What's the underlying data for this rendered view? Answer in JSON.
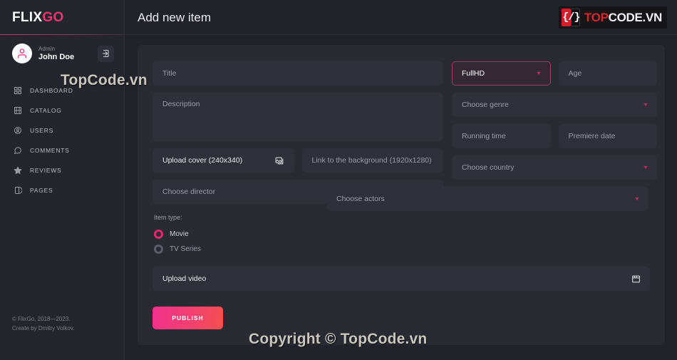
{
  "brand": {
    "part1": "FLIX",
    "part2": "GO"
  },
  "user": {
    "role": "Admin",
    "name": "John Doe",
    "logout_icon": "logout-icon",
    "avatar_icon": "user-avatar-icon"
  },
  "sidebar": {
    "items": [
      {
        "label": "DASHBOARD",
        "icon": "grid-icon"
      },
      {
        "label": "CATALOG",
        "icon": "film-icon"
      },
      {
        "label": "USERS",
        "icon": "user-circle-icon"
      },
      {
        "label": "COMMENTS",
        "icon": "comment-icon"
      },
      {
        "label": "REVIEWS",
        "icon": "star-icon"
      },
      {
        "label": "PAGES",
        "icon": "pages-icon"
      }
    ],
    "footer_line1": "© FlixGo, 2018—2023.",
    "footer_line2": "Create by Dmitry Volkov."
  },
  "header": {
    "title": "Add new item",
    "logo": {
      "glyph": "{/}",
      "word1": "TOP",
      "word2": "CODE.VN"
    }
  },
  "form": {
    "title_placeholder": "Title",
    "description_placeholder": "Description",
    "quality_value": "FullHD",
    "age_placeholder": "Age",
    "genre_placeholder": "Choose genre",
    "running_time_placeholder": "Running time",
    "premiere_date_placeholder": "Premiere date",
    "upload_cover_label": "Upload cover (240x340)",
    "upload_cover_icon": "image-icon",
    "background_link_placeholder": "Link to the background (1920x1280)",
    "country_placeholder": "Choose country",
    "director_placeholder": "Choose director",
    "actors_placeholder": "Choose actors",
    "item_type_label": "Item type:",
    "item_type_options": [
      {
        "label": "Movie",
        "selected": true
      },
      {
        "label": "TV Series",
        "selected": false
      }
    ],
    "upload_video_label": "Upload video",
    "upload_video_icon": "clapperboard-icon",
    "publish_label": "PUBLISH",
    "chevron_icon": "chevron-down-icon"
  },
  "watermarks": {
    "top": "TopCode.vn",
    "bottom": "Copyright © TopCode.vn"
  },
  "colors": {
    "accent_pink": "#e9266f",
    "accent_red": "#f5504f",
    "page_bg": "#22222a",
    "card_bg": "#2a2a33",
    "field_bg": "#30303a",
    "sidebar_bg": "#25252e",
    "logo_red": "#d9252f"
  }
}
